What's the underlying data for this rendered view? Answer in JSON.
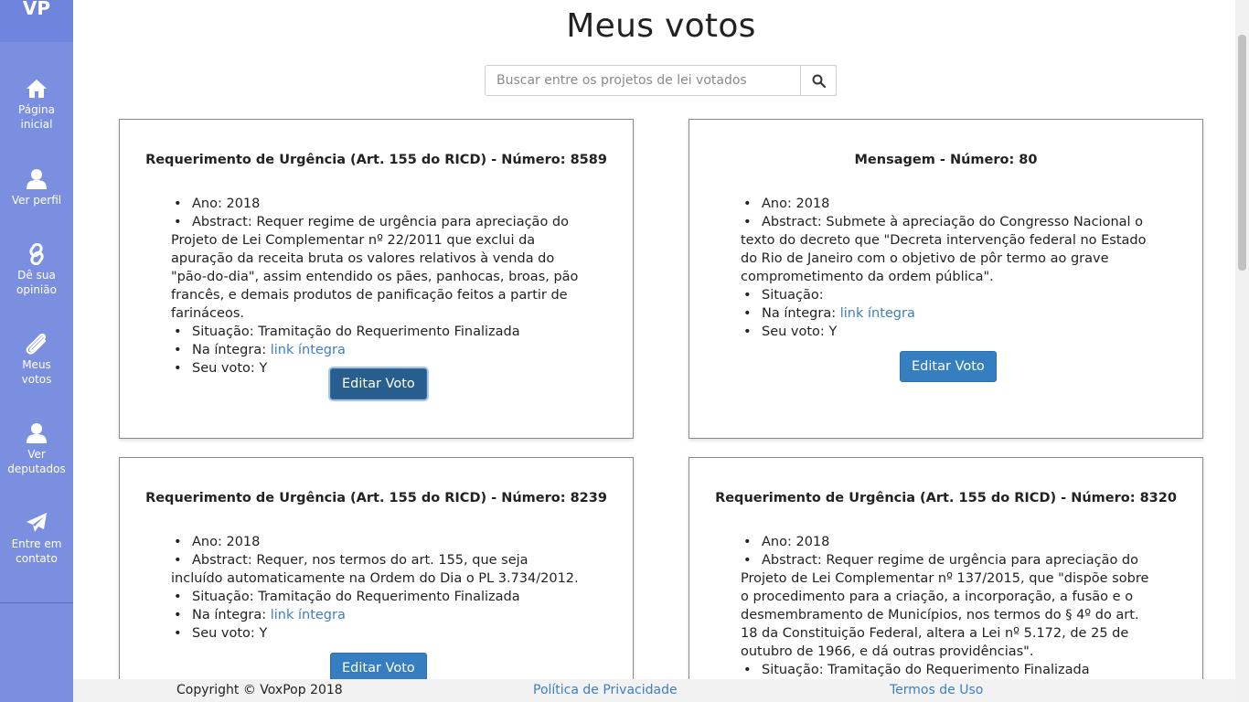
{
  "app": {
    "logo": "VP",
    "colors": {
      "sidebar": "#7b8fe0",
      "primary_button": "#357ec0",
      "link": "#3f7ec0"
    }
  },
  "sidebar": {
    "items": [
      {
        "icon": "home-icon",
        "line1": "Página",
        "line2": "inicial"
      },
      {
        "icon": "user-icon",
        "line1": "Ver perfil",
        "line2": ""
      },
      {
        "icon": "link-icon",
        "line1": "Dê sua",
        "line2": "opinião"
      },
      {
        "icon": "paperclip-icon",
        "line1": "Meus",
        "line2": "votos"
      },
      {
        "icon": "user-icon",
        "line1": "Ver",
        "line2": "deputados"
      },
      {
        "icon": "paper-plane-icon",
        "line1": "Entre em",
        "line2": "contato"
      }
    ]
  },
  "main": {
    "title": "Meus votos",
    "search": {
      "placeholder": "Buscar entre os projetos de lei votados",
      "icon": "search-icon"
    }
  },
  "cards": [
    {
      "title": "Requerimento de Urgência (Art. 155 do RICD) - Número: 8589",
      "ano_label": "Ano:",
      "ano": "2018",
      "abstract_label": "Abstract:",
      "abstract": "Requer regime de urgência para apreciação do Projeto de Lei Complementar nº 22/2011 que exclui da apuração da receita bruta os valores relativos à venda do \"pão-do-dia\", assim entendido os pães, panhocas, broas, pão francês, e demais produtos de panificação feitos a partir de farináceos.",
      "situacao_label": "Situação:",
      "situacao": "Tramitação do Requerimento Finalizada",
      "integra_label": "Na íntegra:",
      "integra_link": "link íntegra",
      "voto_label": "Seu voto:",
      "voto": "Y",
      "button": "Editar Voto"
    },
    {
      "title": "Mensagem - Número: 80",
      "ano_label": "Ano:",
      "ano": "2018",
      "abstract_label": "Abstract:",
      "abstract": "Submete à apreciação do Congresso Nacional o texto do decreto que \"Decreta intervenção federal no Estado do Rio de Janeiro com o objetivo de pôr termo ao grave comprometimento da ordem pública\".",
      "situacao_label": "Situação:",
      "situacao": "",
      "integra_label": "Na íntegra:",
      "integra_link": "link íntegra",
      "voto_label": "Seu voto:",
      "voto": "Y",
      "button": "Editar Voto"
    },
    {
      "title": "Requerimento de Urgência (Art. 155 do RICD) - Número: 8239",
      "ano_label": "Ano:",
      "ano": "2018",
      "abstract_label": "Abstract:",
      "abstract": "Requer, nos termos do art. 155, que seja incluído automaticamente na Ordem do Dia o PL 3.734/2012.",
      "situacao_label": "Situação:",
      "situacao": "Tramitação do Requerimento Finalizada",
      "integra_label": "Na íntegra:",
      "integra_link": "link íntegra",
      "voto_label": "Seu voto:",
      "voto": "Y",
      "button": "Editar Voto"
    },
    {
      "title": "Requerimento de Urgência (Art. 155 do RICD) - Número: 8320",
      "ano_label": "Ano:",
      "ano": "2018",
      "abstract_label": "Abstract:",
      "abstract": "Requer regime de urgência para apreciação do Projeto de Lei Complementar nº 137/2015, que \"dispõe sobre o procedimento para a criação, a incorporação, a fusão e o desmembramento de Municípios, nos termos do § 4º do art. 18 da Constituição Federal, altera a Lei nº 5.172, de 25 de outubro de 1966, e dá outras providências\".",
      "situacao_label": "Situação:",
      "situacao": "Tramitação do Requerimento Finalizada"
    }
  ],
  "footer": {
    "copyright": "Copyright © VoxPop 2018",
    "privacy": "Política de Privacidade",
    "terms": "Termos de Uso"
  }
}
